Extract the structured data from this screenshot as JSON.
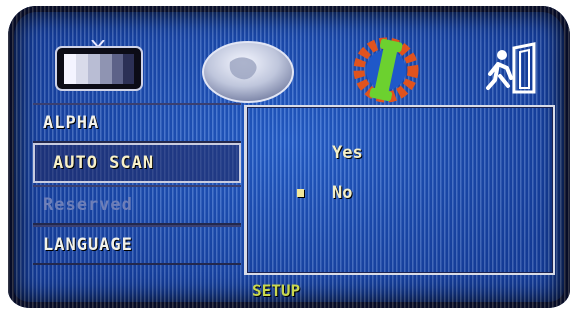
{
  "icons": [
    "tv-icon",
    "globe-icon",
    "settings-gear-icon",
    "exit-icon"
  ],
  "menu": {
    "items": [
      {
        "label": "ALPHA",
        "state": "normal"
      },
      {
        "label": "AUTO SCAN",
        "state": "selected"
      },
      {
        "label": "Reserved",
        "state": "disabled"
      },
      {
        "label": "LANGUAGE",
        "state": "normal"
      }
    ]
  },
  "options": {
    "yes_label": "Yes",
    "no_label": "No",
    "selected": "No"
  },
  "footer": {
    "label": "SETUP"
  },
  "colors": {
    "screen_bg": "#1f58c9",
    "text": "#f2f2ea",
    "footer_text": "#c9d84f",
    "bullet": "#f0e69a"
  }
}
